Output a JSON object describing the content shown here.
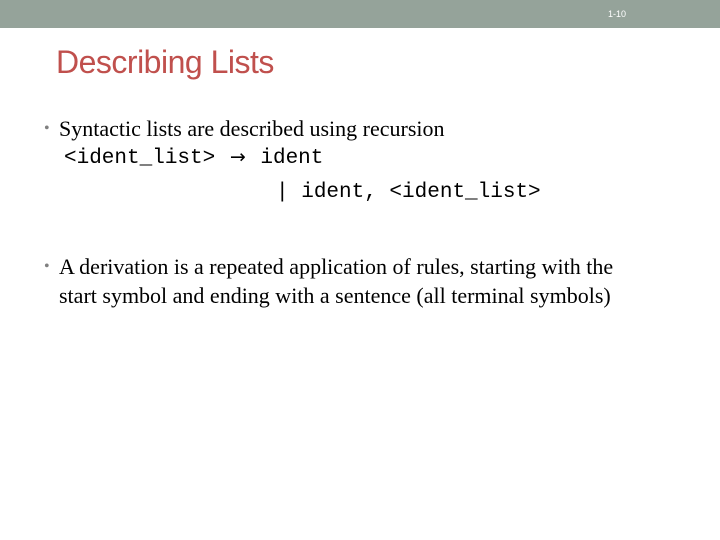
{
  "header": {
    "slide_number": "1-10"
  },
  "slide": {
    "title": "Describing Lists",
    "bullet_marker": "•",
    "bullets": [
      {
        "text": "Syntactic lists are described using recursion"
      },
      {
        "text": "A derivation is a repeated application of rules, starting with the start symbol and ending with a sentence (all terminal symbols)"
      }
    ],
    "grammar": {
      "lhs": "<ident_list>",
      "arrow": "→",
      "rhs_1": "ident",
      "alt_bar": "|",
      "rhs_2": "ident, <ident_list>"
    }
  },
  "colors": {
    "top_bar": "#95a39a",
    "title": "#c0504d",
    "bullet_marker": "#808080"
  }
}
